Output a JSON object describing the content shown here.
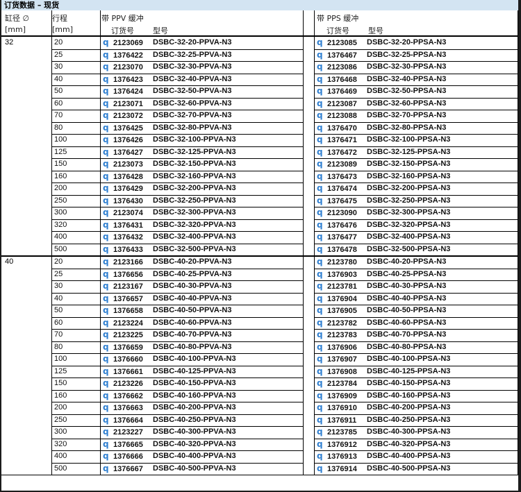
{
  "title": "订货数据 – 现货",
  "headers": {
    "bore_label": "缸径 ∅",
    "bore_unit": "[mm]",
    "stroke_label": "行程",
    "stroke_unit": "[mm]",
    "ppv_group": "带 PPV 缓冲",
    "pps_group": "带 PPS 缓冲",
    "order_no": "订货号",
    "model": "型号"
  },
  "order_icon": "q-order-icon",
  "accent_color": "#2f7fd0",
  "groups": [
    {
      "bore": "32",
      "rows": [
        {
          "stroke": "20",
          "ppv_no": "2123069",
          "ppv_model": "DSBC-32-20-PPVA-N3",
          "pps_no": "2123085",
          "pps_model": "DSBC-32-20-PPSA-N3"
        },
        {
          "stroke": "25",
          "ppv_no": "1376422",
          "ppv_model": "DSBC-32-25-PPVA-N3",
          "pps_no": "1376467",
          "pps_model": "DSBC-32-25-PPSA-N3"
        },
        {
          "stroke": "30",
          "ppv_no": "2123070",
          "ppv_model": "DSBC-32-30-PPVA-N3",
          "pps_no": "2123086",
          "pps_model": "DSBC-32-30-PPSA-N3"
        },
        {
          "stroke": "40",
          "ppv_no": "1376423",
          "ppv_model": "DSBC-32-40-PPVA-N3",
          "pps_no": "1376468",
          "pps_model": "DSBC-32-40-PPSA-N3"
        },
        {
          "stroke": "50",
          "ppv_no": "1376424",
          "ppv_model": "DSBC-32-50-PPVA-N3",
          "pps_no": "1376469",
          "pps_model": "DSBC-32-50-PPSA-N3"
        },
        {
          "stroke": "60",
          "ppv_no": "2123071",
          "ppv_model": "DSBC-32-60-PPVA-N3",
          "pps_no": "2123087",
          "pps_model": "DSBC-32-60-PPSA-N3"
        },
        {
          "stroke": "70",
          "ppv_no": "2123072",
          "ppv_model": "DSBC-32-70-PPVA-N3",
          "pps_no": "2123088",
          "pps_model": "DSBC-32-70-PPSA-N3"
        },
        {
          "stroke": "80",
          "ppv_no": "1376425",
          "ppv_model": "DSBC-32-80-PPVA-N3",
          "pps_no": "1376470",
          "pps_model": "DSBC-32-80-PPSA-N3"
        },
        {
          "stroke": "100",
          "ppv_no": "1376426",
          "ppv_model": "DSBC-32-100-PPVA-N3",
          "pps_no": "1376471",
          "pps_model": "DSBC-32-100-PPSA-N3"
        },
        {
          "stroke": "125",
          "ppv_no": "1376427",
          "ppv_model": "DSBC-32-125-PPVA-N3",
          "pps_no": "1376472",
          "pps_model": "DSBC-32-125-PPSA-N3"
        },
        {
          "stroke": "150",
          "ppv_no": "2123073",
          "ppv_model": "DSBC-32-150-PPVA-N3",
          "pps_no": "2123089",
          "pps_model": "DSBC-32-150-PPSA-N3"
        },
        {
          "stroke": "160",
          "ppv_no": "1376428",
          "ppv_model": "DSBC-32-160-PPVA-N3",
          "pps_no": "1376473",
          "pps_model": "DSBC-32-160-PPSA-N3"
        },
        {
          "stroke": "200",
          "ppv_no": "1376429",
          "ppv_model": "DSBC-32-200-PPVA-N3",
          "pps_no": "1376474",
          "pps_model": "DSBC-32-200-PPSA-N3"
        },
        {
          "stroke": "250",
          "ppv_no": "1376430",
          "ppv_model": "DSBC-32-250-PPVA-N3",
          "pps_no": "1376475",
          "pps_model": "DSBC-32-250-PPSA-N3"
        },
        {
          "stroke": "300",
          "ppv_no": "2123074",
          "ppv_model": "DSBC-32-300-PPVA-N3",
          "pps_no": "2123090",
          "pps_model": "DSBC-32-300-PPSA-N3"
        },
        {
          "stroke": "320",
          "ppv_no": "1376431",
          "ppv_model": "DSBC-32-320-PPVA-N3",
          "pps_no": "1376476",
          "pps_model": "DSBC-32-320-PPSA-N3"
        },
        {
          "stroke": "400",
          "ppv_no": "1376432",
          "ppv_model": "DSBC-32-400-PPVA-N3",
          "pps_no": "1376477",
          "pps_model": "DSBC-32-400-PPSA-N3"
        },
        {
          "stroke": "500",
          "ppv_no": "1376433",
          "ppv_model": "DSBC-32-500-PPVA-N3",
          "pps_no": "1376478",
          "pps_model": "DSBC-32-500-PPSA-N3"
        }
      ]
    },
    {
      "bore": "40",
      "rows": [
        {
          "stroke": "20",
          "ppv_no": "2123166",
          "ppv_model": "DSBC-40-20-PPVA-N3",
          "pps_no": "2123780",
          "pps_model": "DSBC-40-20-PPSA-N3"
        },
        {
          "stroke": "25",
          "ppv_no": "1376656",
          "ppv_model": "DSBC-40-25-PPVA-N3",
          "pps_no": "1376903",
          "pps_model": "DSBC-40-25-PPSA-N3"
        },
        {
          "stroke": "30",
          "ppv_no": "2123167",
          "ppv_model": "DSBC-40-30-PPVA-N3",
          "pps_no": "2123781",
          "pps_model": "DSBC-40-30-PPSA-N3"
        },
        {
          "stroke": "40",
          "ppv_no": "1376657",
          "ppv_model": "DSBC-40-40-PPVA-N3",
          "pps_no": "1376904",
          "pps_model": "DSBC-40-40-PPSA-N3"
        },
        {
          "stroke": "50",
          "ppv_no": "1376658",
          "ppv_model": "DSBC-40-50-PPVA-N3",
          "pps_no": "1376905",
          "pps_model": "DSBC-40-50-PPSA-N3"
        },
        {
          "stroke": "60",
          "ppv_no": "2123224",
          "ppv_model": "DSBC-40-60-PPVA-N3",
          "pps_no": "2123782",
          "pps_model": "DSBC-40-60-PPSA-N3"
        },
        {
          "stroke": "70",
          "ppv_no": "2123225",
          "ppv_model": "DSBC-40-70-PPVA-N3",
          "pps_no": "2123783",
          "pps_model": "DSBC-40-70-PPSA-N3"
        },
        {
          "stroke": "80",
          "ppv_no": "1376659",
          "ppv_model": "DSBC-40-80-PPVA-N3",
          "pps_no": "1376906",
          "pps_model": "DSBC-40-80-PPSA-N3"
        },
        {
          "stroke": "100",
          "ppv_no": "1376660",
          "ppv_model": "DSBC-40-100-PPVA-N3",
          "pps_no": "1376907",
          "pps_model": "DSBC-40-100-PPSA-N3"
        },
        {
          "stroke": "125",
          "ppv_no": "1376661",
          "ppv_model": "DSBC-40-125-PPVA-N3",
          "pps_no": "1376908",
          "pps_model": "DSBC-40-125-PPSA-N3"
        },
        {
          "stroke": "150",
          "ppv_no": "2123226",
          "ppv_model": "DSBC-40-150-PPVA-N3",
          "pps_no": "2123784",
          "pps_model": "DSBC-40-150-PPSA-N3"
        },
        {
          "stroke": "160",
          "ppv_no": "1376662",
          "ppv_model": "DSBC-40-160-PPVA-N3",
          "pps_no": "1376909",
          "pps_model": "DSBC-40-160-PPSA-N3"
        },
        {
          "stroke": "200",
          "ppv_no": "1376663",
          "ppv_model": "DSBC-40-200-PPVA-N3",
          "pps_no": "1376910",
          "pps_model": "DSBC-40-200-PPSA-N3"
        },
        {
          "stroke": "250",
          "ppv_no": "1376664",
          "ppv_model": "DSBC-40-250-PPVA-N3",
          "pps_no": "1376911",
          "pps_model": "DSBC-40-250-PPSA-N3"
        },
        {
          "stroke": "300",
          "ppv_no": "2123227",
          "ppv_model": "DSBC-40-300-PPVA-N3",
          "pps_no": "2123785",
          "pps_model": "DSBC-40-300-PPSA-N3"
        },
        {
          "stroke": "320",
          "ppv_no": "1376665",
          "ppv_model": "DSBC-40-320-PPVA-N3",
          "pps_no": "1376912",
          "pps_model": "DSBC-40-320-PPSA-N3"
        },
        {
          "stroke": "400",
          "ppv_no": "1376666",
          "ppv_model": "DSBC-40-400-PPVA-N3",
          "pps_no": "1376913",
          "pps_model": "DSBC-40-400-PPSA-N3"
        },
        {
          "stroke": "500",
          "ppv_no": "1376667",
          "ppv_model": "DSBC-40-500-PPVA-N3",
          "pps_no": "1376914",
          "pps_model": "DSBC-40-500-PPSA-N3"
        }
      ]
    }
  ]
}
